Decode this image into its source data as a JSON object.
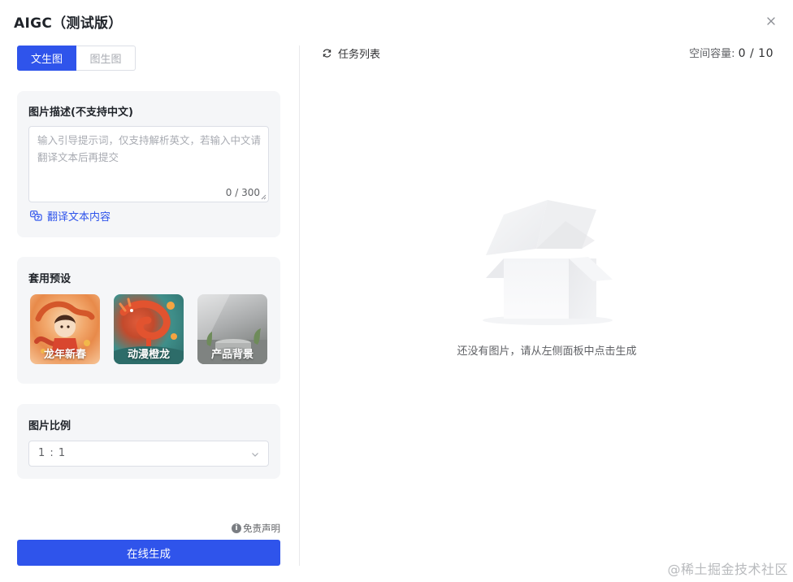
{
  "dialog": {
    "title": "AIGC（测试版）",
    "close_icon": "close-icon"
  },
  "tabs": [
    {
      "label": "文生图",
      "active": true
    },
    {
      "label": "图生图",
      "active": false
    }
  ],
  "description": {
    "title": "图片描述(不支持中文)",
    "placeholder": "输入引导提示词，仅支持解析英文，若输入中文请翻译文本后再提交",
    "counter": "0 / 300",
    "translate_label": "翻译文本内容",
    "translate_icon": "translate-icon"
  },
  "preset": {
    "title": "套用预设",
    "items": [
      {
        "label": "龙年新春"
      },
      {
        "label": "动漫橙龙"
      },
      {
        "label": "产品背景"
      }
    ]
  },
  "ratio": {
    "title": "图片比例",
    "value": "1 : 1",
    "chevron_icon": "chevron-down-icon"
  },
  "footer": {
    "disclaimer_label": "免责声明",
    "disclaimer_icon": "info-icon",
    "generate_label": "在线生成"
  },
  "tasks": {
    "title": "任务列表",
    "refresh_icon": "refresh-icon",
    "capacity_label": "空间容量:",
    "capacity_value": "0 / 10",
    "empty_text": "还没有图片，请从左侧面板中点击生成"
  },
  "watermark": "@稀土掘金技术社区",
  "colors": {
    "primary": "#2f54eb",
    "card_bg": "#f5f6f8",
    "border": "#dcdfe6",
    "placeholder": "#a8abb2"
  }
}
